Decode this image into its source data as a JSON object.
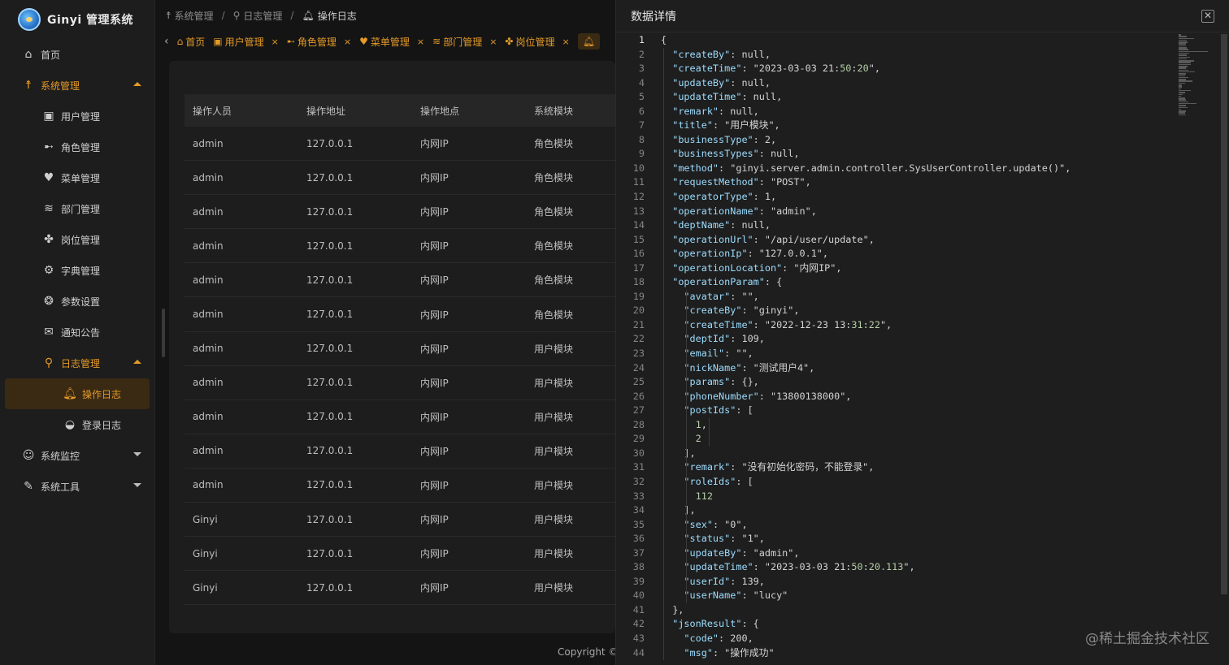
{
  "brand": {
    "title": "Ginyi 管理系统"
  },
  "sidebar": {
    "items": [
      {
        "label": "首页",
        "icon": "home-icon",
        "level": 1
      },
      {
        "label": "系统管理",
        "icon": "person-icon",
        "level": 1,
        "expanded": true
      },
      {
        "label": "用户管理",
        "icon": "user-add-icon",
        "level": 2
      },
      {
        "label": "角色管理",
        "icon": "role-icon",
        "level": 2
      },
      {
        "label": "菜单管理",
        "icon": "heart-icon",
        "level": 2
      },
      {
        "label": "部门管理",
        "icon": "layers-icon",
        "level": 2
      },
      {
        "label": "岗位管理",
        "icon": "paw-icon",
        "level": 2
      },
      {
        "label": "字典管理",
        "icon": "gear-icon",
        "level": 2
      },
      {
        "label": "参数设置",
        "icon": "chat-icon",
        "level": 2
      },
      {
        "label": "通知公告",
        "icon": "mail-icon",
        "level": 2
      },
      {
        "label": "日志管理",
        "icon": "mic-icon",
        "level": 2,
        "expanded": true
      },
      {
        "label": "操作日志",
        "icon": "bell-icon",
        "level": 3,
        "active": true
      },
      {
        "label": "登录日志",
        "icon": "planet-icon",
        "level": 3
      },
      {
        "label": "系统监控",
        "icon": "user-icon",
        "level": 1,
        "collapsed": true
      },
      {
        "label": "系统工具",
        "icon": "wrench-icon",
        "level": 1,
        "collapsed": true
      }
    ]
  },
  "breadcrumb": [
    "系统管理",
    "日志管理",
    "操作日志"
  ],
  "tabs": [
    {
      "label": "首页"
    },
    {
      "label": "用户管理"
    },
    {
      "label": "角色管理"
    },
    {
      "label": "菜单管理"
    },
    {
      "label": "部门管理"
    },
    {
      "label": "岗位管理"
    }
  ],
  "table": {
    "headers": [
      "操作人员",
      "操作地址",
      "操作地点",
      "系统模块"
    ],
    "rows": [
      [
        "admin",
        "127.0.0.1",
        "内网IP",
        "角色模块"
      ],
      [
        "admin",
        "127.0.0.1",
        "内网IP",
        "角色模块"
      ],
      [
        "admin",
        "127.0.0.1",
        "内网IP",
        "角色模块"
      ],
      [
        "admin",
        "127.0.0.1",
        "内网IP",
        "角色模块"
      ],
      [
        "admin",
        "127.0.0.1",
        "内网IP",
        "角色模块"
      ],
      [
        "admin",
        "127.0.0.1",
        "内网IP",
        "角色模块"
      ],
      [
        "admin",
        "127.0.0.1",
        "内网IP",
        "用户模块"
      ],
      [
        "admin",
        "127.0.0.1",
        "内网IP",
        "用户模块"
      ],
      [
        "admin",
        "127.0.0.1",
        "内网IP",
        "用户模块"
      ],
      [
        "admin",
        "127.0.0.1",
        "内网IP",
        "用户模块"
      ],
      [
        "admin",
        "127.0.0.1",
        "内网IP",
        "用户模块"
      ],
      [
        "Ginyi",
        "127.0.0.1",
        "内网IP",
        "用户模块"
      ],
      [
        "Ginyi",
        "127.0.0.1",
        "内网IP",
        "用户模块"
      ],
      [
        "Ginyi",
        "127.0.0.1",
        "内网IP",
        "用户模块"
      ]
    ]
  },
  "footer": {
    "copyright": "Copyright ©"
  },
  "drawer": {
    "title": "数据详情",
    "code_lines": [
      "{",
      "  \"createBy\": null,",
      "  \"createTime\": \"2023-03-03 21:50:20\",",
      "  \"updateBy\": null,",
      "  \"updateTime\": null,",
      "  \"remark\": null,",
      "  \"title\": \"用户模块\",",
      "  \"businessType\": 2,",
      "  \"businessTypes\": null,",
      "  \"method\": \"ginyi.server.admin.controller.SysUserController.update()\",",
      "  \"requestMethod\": \"POST\",",
      "  \"operatorType\": 1,",
      "  \"operationName\": \"admin\",",
      "  \"deptName\": null,",
      "  \"operationUrl\": \"/api/user/update\",",
      "  \"operationIp\": \"127.0.0.1\",",
      "  \"operationLocation\": \"内网IP\",",
      "  \"operationParam\": {",
      "    \"avatar\": \"\",",
      "    \"createBy\": \"ginyi\",",
      "    \"createTime\": \"2022-12-23 13:31:22\",",
      "    \"deptId\": 109,",
      "    \"email\": \"\",",
      "    \"nickName\": \"测试用户4\",",
      "    \"params\": {},",
      "    \"phoneNumber\": \"13800138000\",",
      "    \"postIds\": [",
      "      1,",
      "      2",
      "    ],",
      "    \"remark\": \"没有初始化密码，不能登录\",",
      "    \"roleIds\": [",
      "      112",
      "    ],",
      "    \"sex\": \"0\",",
      "    \"status\": \"1\",",
      "    \"updateBy\": \"admin\",",
      "    \"updateTime\": \"2023-03-03 21:50:20.113\",",
      "    \"userId\": 139,",
      "    \"userName\": \"lucy\"",
      "  },",
      "  \"jsonResult\": {",
      "    \"code\": 200,",
      "    \"msg\": \"操作成功\""
    ]
  },
  "watermark": "@稀土掘金技术社区",
  "colors": {
    "accent": "#e59a27",
    "background": "#141414",
    "panel": "#1d1d1d"
  }
}
